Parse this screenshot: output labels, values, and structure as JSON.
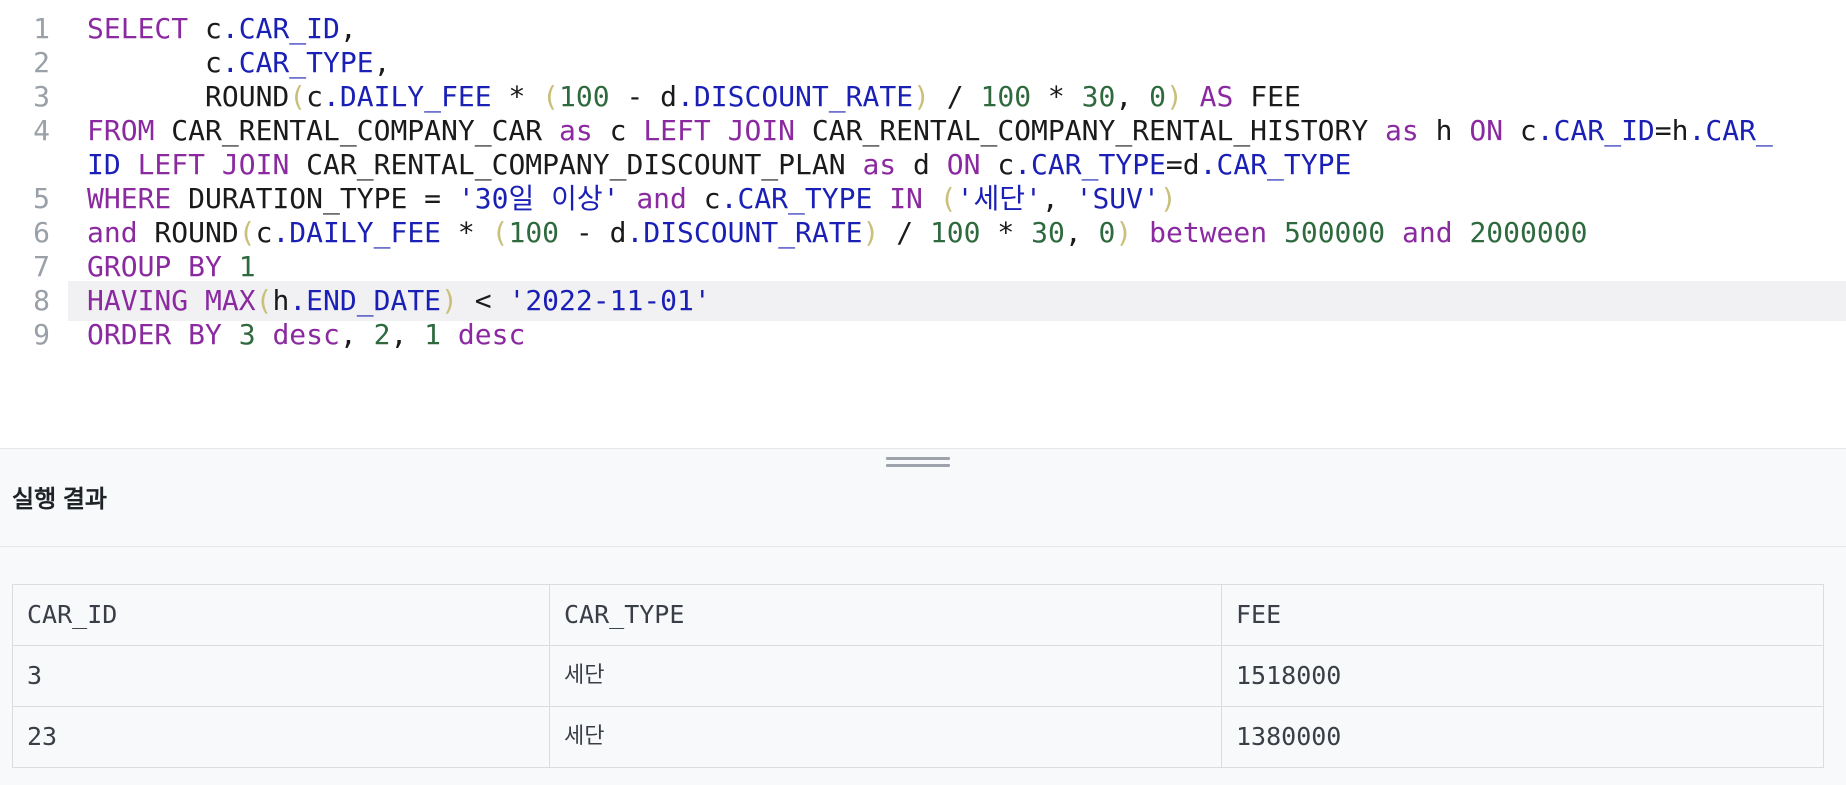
{
  "editor": {
    "lines": [
      {
        "number": "1",
        "tokens": [
          [
            "kw",
            "SELECT"
          ],
          [
            "pl",
            " c"
          ],
          [
            "pr",
            ".CAR_ID"
          ],
          [
            "pl",
            ","
          ]
        ]
      },
      {
        "number": "2",
        "tokens": [
          [
            "pl",
            "       c"
          ],
          [
            "pr",
            ".CAR_TYPE"
          ],
          [
            "pl",
            ","
          ]
        ]
      },
      {
        "number": "3",
        "tokens": [
          [
            "pl",
            "       ROUND"
          ],
          [
            "br",
            "("
          ],
          [
            "pl",
            "c"
          ],
          [
            "pr",
            ".DAILY_FEE"
          ],
          [
            "pl",
            " * "
          ],
          [
            "br",
            "("
          ],
          [
            "nm",
            "100"
          ],
          [
            "pl",
            " - d"
          ],
          [
            "pr",
            ".DISCOUNT_RATE"
          ],
          [
            "br",
            ")"
          ],
          [
            "pl",
            " / "
          ],
          [
            "nm",
            "100"
          ],
          [
            "pl",
            " * "
          ],
          [
            "nm",
            "30"
          ],
          [
            "pl",
            ", "
          ],
          [
            "nm",
            "0"
          ],
          [
            "br",
            ")"
          ],
          [
            "pl",
            " "
          ],
          [
            "kw",
            "AS"
          ],
          [
            "pl",
            " FEE"
          ]
        ]
      },
      {
        "number": "4",
        "tokens": [
          [
            "kw",
            "FROM"
          ],
          [
            "pl",
            " CAR_RENTAL_COMPANY_CAR "
          ],
          [
            "kw",
            "as"
          ],
          [
            "pl",
            " c "
          ],
          [
            "kw",
            "LEFT JOIN"
          ],
          [
            "pl",
            " CAR_RENTAL_COMPANY_RENTAL_HISTORY "
          ],
          [
            "kw",
            "as"
          ],
          [
            "pl",
            " h "
          ],
          [
            "kw",
            "ON"
          ],
          [
            "pl",
            " c"
          ],
          [
            "pr",
            ".CAR_ID"
          ],
          [
            "pl",
            "=h"
          ],
          [
            "pr",
            ".CAR_"
          ]
        ]
      },
      {
        "number": "",
        "tokens": [
          [
            "pr",
            "ID"
          ],
          [
            "pl",
            " "
          ],
          [
            "kw",
            "LEFT JOIN"
          ],
          [
            "pl",
            " CAR_RENTAL_COMPANY_DISCOUNT_PLAN "
          ],
          [
            "kw",
            "as"
          ],
          [
            "pl",
            " d "
          ],
          [
            "kw",
            "ON"
          ],
          [
            "pl",
            " c"
          ],
          [
            "pr",
            ".CAR_TYPE"
          ],
          [
            "pl",
            "=d"
          ],
          [
            "pr",
            ".CAR_TYPE"
          ]
        ]
      },
      {
        "number": "5",
        "tokens": [
          [
            "kw",
            "WHERE"
          ],
          [
            "pl",
            " DURATION_TYPE = "
          ],
          [
            "st",
            "'30일 이상'"
          ],
          [
            "pl",
            " "
          ],
          [
            "kw",
            "and"
          ],
          [
            "pl",
            " c"
          ],
          [
            "pr",
            ".CAR_TYPE"
          ],
          [
            "pl",
            " "
          ],
          [
            "kw",
            "IN"
          ],
          [
            "pl",
            " "
          ],
          [
            "br",
            "("
          ],
          [
            "st",
            "'세단'"
          ],
          [
            "pl",
            ", "
          ],
          [
            "st",
            "'SUV'"
          ],
          [
            "br",
            ")"
          ]
        ]
      },
      {
        "number": "6",
        "tokens": [
          [
            "kw",
            "and"
          ],
          [
            "pl",
            " ROUND"
          ],
          [
            "br",
            "("
          ],
          [
            "pl",
            "c"
          ],
          [
            "pr",
            ".DAILY_FEE"
          ],
          [
            "pl",
            " * "
          ],
          [
            "br",
            "("
          ],
          [
            "nm",
            "100"
          ],
          [
            "pl",
            " - d"
          ],
          [
            "pr",
            ".DISCOUNT_RATE"
          ],
          [
            "br",
            ")"
          ],
          [
            "pl",
            " / "
          ],
          [
            "nm",
            "100"
          ],
          [
            "pl",
            " * "
          ],
          [
            "nm",
            "30"
          ],
          [
            "pl",
            ", "
          ],
          [
            "nm",
            "0"
          ],
          [
            "br",
            ")"
          ],
          [
            "pl",
            " "
          ],
          [
            "kw",
            "between"
          ],
          [
            "pl",
            " "
          ],
          [
            "nm",
            "500000"
          ],
          [
            "pl",
            " "
          ],
          [
            "kw",
            "and"
          ],
          [
            "pl",
            " "
          ],
          [
            "nm",
            "2000000"
          ]
        ]
      },
      {
        "number": "7",
        "tokens": [
          [
            "kw",
            "GROUP BY"
          ],
          [
            "pl",
            " "
          ],
          [
            "nm",
            "1"
          ]
        ]
      },
      {
        "number": "8",
        "tokens": [
          [
            "kw",
            "HAVING"
          ],
          [
            "pl",
            " "
          ],
          [
            "kw",
            "MAX"
          ],
          [
            "br",
            "("
          ],
          [
            "pl",
            "h"
          ],
          [
            "pr",
            ".END_DATE"
          ],
          [
            "br",
            ")"
          ],
          [
            "pl",
            " < "
          ],
          [
            "st",
            "'2022-11-01'"
          ]
        ]
      },
      {
        "number": "9",
        "tokens": [
          [
            "kw",
            "ORDER BY"
          ],
          [
            "pl",
            " "
          ],
          [
            "nm",
            "3"
          ],
          [
            "pl",
            " "
          ],
          [
            "kw",
            "desc"
          ],
          [
            "pl",
            ", "
          ],
          [
            "nm",
            "2"
          ],
          [
            "pl",
            ", "
          ],
          [
            "nm",
            "1"
          ],
          [
            "pl",
            " "
          ],
          [
            "kw",
            "desc"
          ]
        ]
      }
    ]
  },
  "result": {
    "title": "실행 결과",
    "columns": [
      "CAR_ID",
      "CAR_TYPE",
      "FEE"
    ],
    "rows": [
      [
        "3",
        "세단",
        "1518000"
      ],
      [
        "23",
        "세단",
        "1380000"
      ]
    ]
  }
}
